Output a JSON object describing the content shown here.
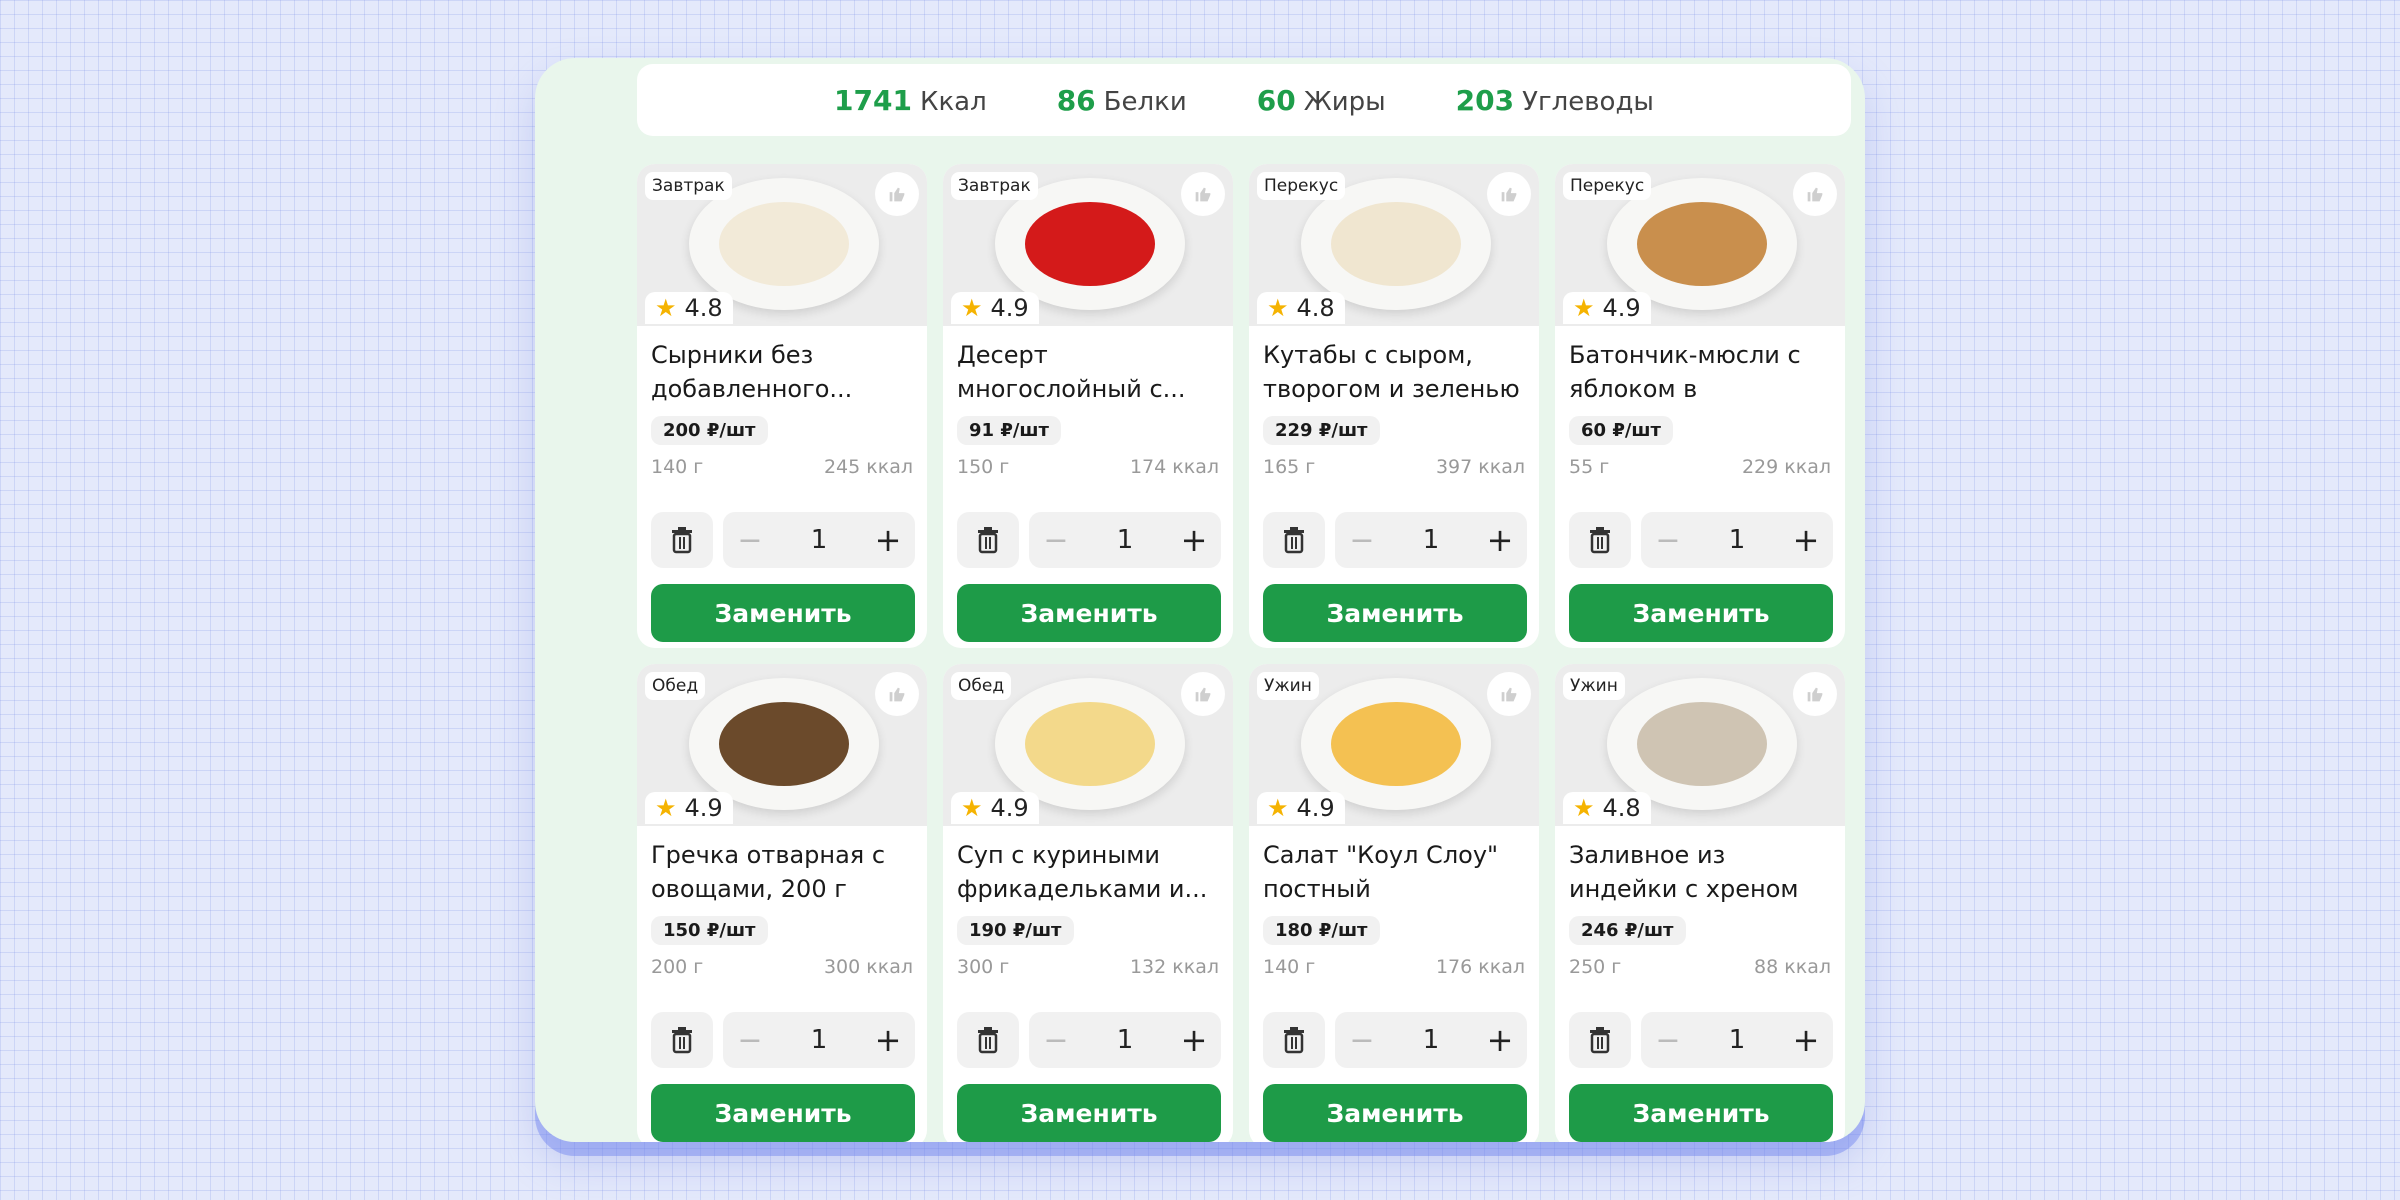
{
  "summary": {
    "kcal": {
      "value": "1741",
      "label": "Ккал"
    },
    "protein": {
      "value": "86",
      "label": "Белки"
    },
    "fat": {
      "value": "60",
      "label": "Жиры"
    },
    "carbs": {
      "value": "203",
      "label": "Углеводы"
    }
  },
  "replace_label": "Заменить",
  "cards": [
    {
      "tag": "Завтрак",
      "rating": "4.8",
      "title": "Сырники без добавленного...",
      "price": "200 ₽/шт",
      "weight": "140 г",
      "kcal": "245 ккал",
      "qty": "1",
      "food_color": "#f2ead8"
    },
    {
      "tag": "Завтрак",
      "rating": "4.9",
      "title": "Десерт многослойный с...",
      "price": "91 ₽/шт",
      "weight": "150 г",
      "kcal": "174 ккал",
      "qty": "1",
      "food_color": "#d41a1a"
    },
    {
      "tag": "Перекус",
      "rating": "4.8",
      "title": "Кутабы с сыром, творогом и зеленью",
      "price": "229 ₽/шт",
      "weight": "165 г",
      "kcal": "397 ккал",
      "qty": "1",
      "food_color": "#f0e6d0"
    },
    {
      "tag": "Перекус",
      "rating": "4.9",
      "title": "Батончик-мюсли с яблоком в карамели...",
      "price": "60 ₽/шт",
      "weight": "55 г",
      "kcal": "229 ккал",
      "qty": "1",
      "food_color": "#c98f4d"
    },
    {
      "tag": "Обед",
      "rating": "4.9",
      "title": "Гречка отварная с овощами, 200 г",
      "price": "150 ₽/шт",
      "weight": "200 г",
      "kcal": "300 ккал",
      "qty": "1",
      "food_color": "#6b4a2b"
    },
    {
      "tag": "Обед",
      "rating": "4.9",
      "title": "Суп с куриными фрикадельками и...",
      "price": "190 ₽/шт",
      "weight": "300 г",
      "kcal": "132 ккал",
      "qty": "1",
      "food_color": "#f3d98b"
    },
    {
      "tag": "Ужин",
      "rating": "4.9",
      "title": "Салат \"Коул Слоу\" постный",
      "price": "180 ₽/шт",
      "weight": "140 г",
      "kcal": "176 ккал",
      "qty": "1",
      "food_color": "#f4c152"
    },
    {
      "tag": "Ужин",
      "rating": "4.8",
      "title": "Заливное из индейки с хреном",
      "price": "246 ₽/шт",
      "weight": "250 г",
      "kcal": "88 ккал",
      "qty": "1",
      "food_color": "#cfc4b3"
    }
  ]
}
